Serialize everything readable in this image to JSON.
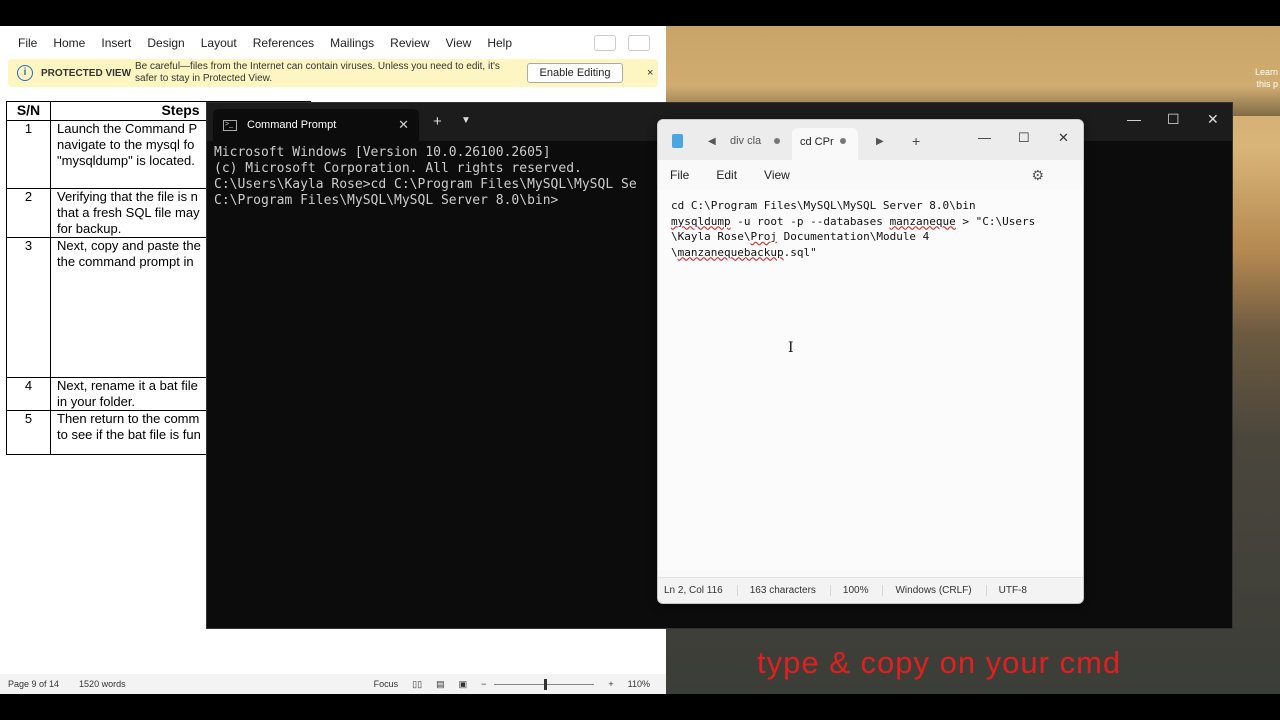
{
  "desktop": {
    "hint_line1": "Learn",
    "hint_line2": "this p",
    "caption": "type & copy on your cmd"
  },
  "word": {
    "menu": [
      "File",
      "Home",
      "Insert",
      "Design",
      "Layout",
      "References",
      "Mailings",
      "Review",
      "View",
      "Help"
    ],
    "protected_view": {
      "title": "PROTECTED VIEW",
      "message": "Be careful—files from the Internet can contain viruses. Unless you need to edit, it's safer to stay in Protected View.",
      "button": "Enable Editing",
      "close": "×"
    },
    "table": {
      "headers": [
        "S/N",
        "Steps"
      ],
      "rows": [
        {
          "sn": "1",
          "lines": [
            "Launch the Command P",
            "navigate to the mysql fo",
            "\"mysqldump\" is located."
          ]
        },
        {
          "sn": "2",
          "lines": [
            "Verifying that the file is n",
            "that a fresh SQL file may",
            "for backup."
          ]
        },
        {
          "sn": "3",
          "lines": [
            "Next, copy and paste the",
            "the command prompt in"
          ]
        },
        {
          "sn": "4",
          "lines": [
            "Next, rename it a bat file",
            "in your folder."
          ]
        },
        {
          "sn": "5",
          "lines": [
            "Then return to the comm",
            "to see if the bat file is fun"
          ]
        }
      ]
    },
    "status": {
      "page": "Page 9 of 14",
      "words": "1520 words",
      "focus": "Focus",
      "zoom": "110%"
    }
  },
  "terminal": {
    "tab_title": "Command Prompt",
    "lines": [
      "Microsoft Windows [Version 10.0.26100.2605]",
      "(c) Microsoft Corporation. All rights reserved.",
      "",
      "C:\\Users\\Kayla Rose>cd C:\\Program Files\\MySQL\\MySQL Se",
      "",
      "C:\\Program Files\\MySQL\\MySQL Server 8.0\\bin>"
    ]
  },
  "notepad": {
    "tab1": "div cla",
    "tab2": "cd CPr",
    "menu": [
      "File",
      "Edit",
      "View"
    ],
    "content_line1": "cd C:\\Program Files\\MySQL\\MySQL Server 8.0\\bin",
    "content_cmd": "mysqldump",
    "content_mid": " -u root -p --databases ",
    "content_db": "manzaneque",
    "content_rest": " > \"C:\\Users\n\\Kayla Rose\\",
    "content_proj": "Proj",
    "content_doc": " Documentation\\Module 4\n\\",
    "content_file": "manzanequebackup",
    "content_end": ".sql\"",
    "status": {
      "position": "Ln 2, Col 116",
      "chars": "163 characters",
      "zoom": "100%",
      "eol": "Windows (CRLF)",
      "encoding": "UTF-8"
    }
  }
}
